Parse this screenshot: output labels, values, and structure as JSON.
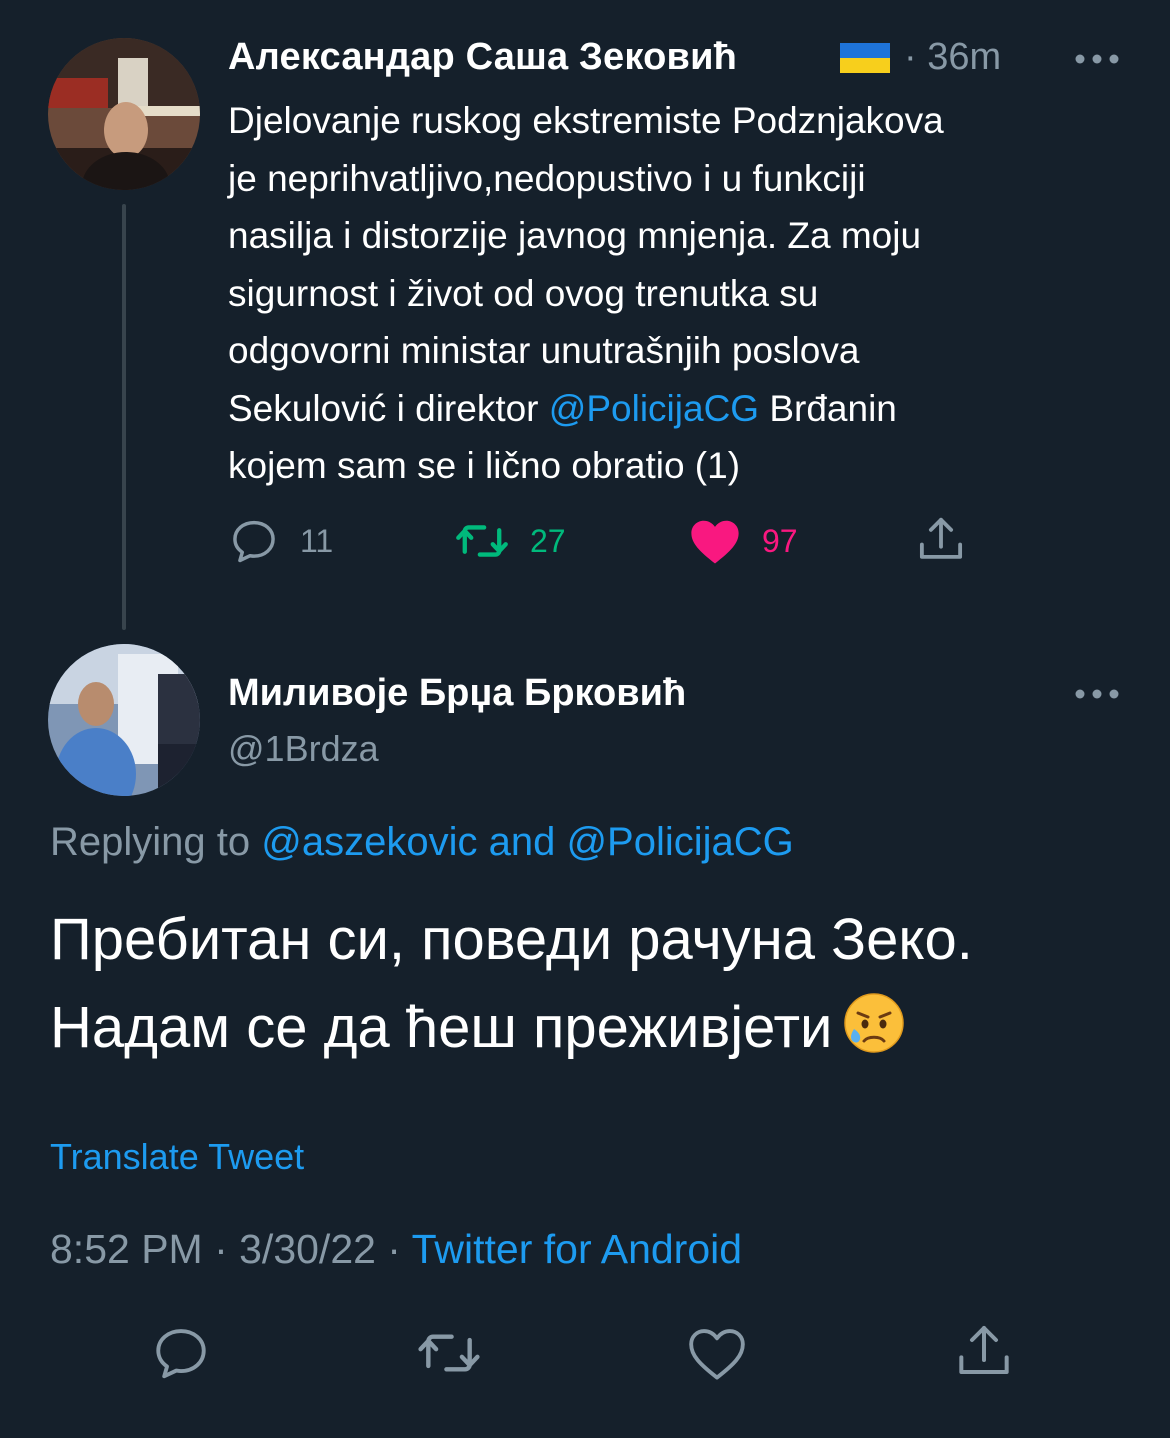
{
  "parent_tweet": {
    "author_name": "Александар Саша Зековић",
    "flag": "ukraine-flag",
    "time": "· 36m",
    "text_before_mention": "Djelovanje ruskog ekstremiste Podznjakova\nje neprihvatljivo,nedopustivo i u funkciji\nnasilja i distorzije javnog mnjenja. Za moju\nsigurnost i život od ovog trenutka su\nodgovorni ministar unutrašnjih poslova\nSekulović i direktor ",
    "mention": "@PolicijaCG",
    "text_after_mention": " Brđanin\nkojem sam se i lično obratio (1)",
    "actions": {
      "reply_count": "11",
      "retweet_count": "27",
      "like_count": "97"
    }
  },
  "reply_tweet": {
    "author_name": "Миливоје Брџа Брковић",
    "handle": "@1Brdza",
    "replying_prefix": "Replying to ",
    "replying_mention_1": "@aszekovic",
    "replying_and": " and ",
    "replying_mention_2": "@PolicijaCG",
    "text_line_1": "Пребитан си, поведи рачуна Зеко.",
    "text_line_2": "Надам се да ћеш преживјети",
    "emoji": "sad-but-relieved-face-icon",
    "translate_label": "Translate Tweet",
    "timestamp": "8:52 PM · 3/30/22 · ",
    "source": "Twitter for Android"
  },
  "colors": {
    "background": "#15202b",
    "secondary_text": "#8899a6",
    "link": "#1d9bf0",
    "retweet": "#00ba7c",
    "like": "#f91880"
  }
}
